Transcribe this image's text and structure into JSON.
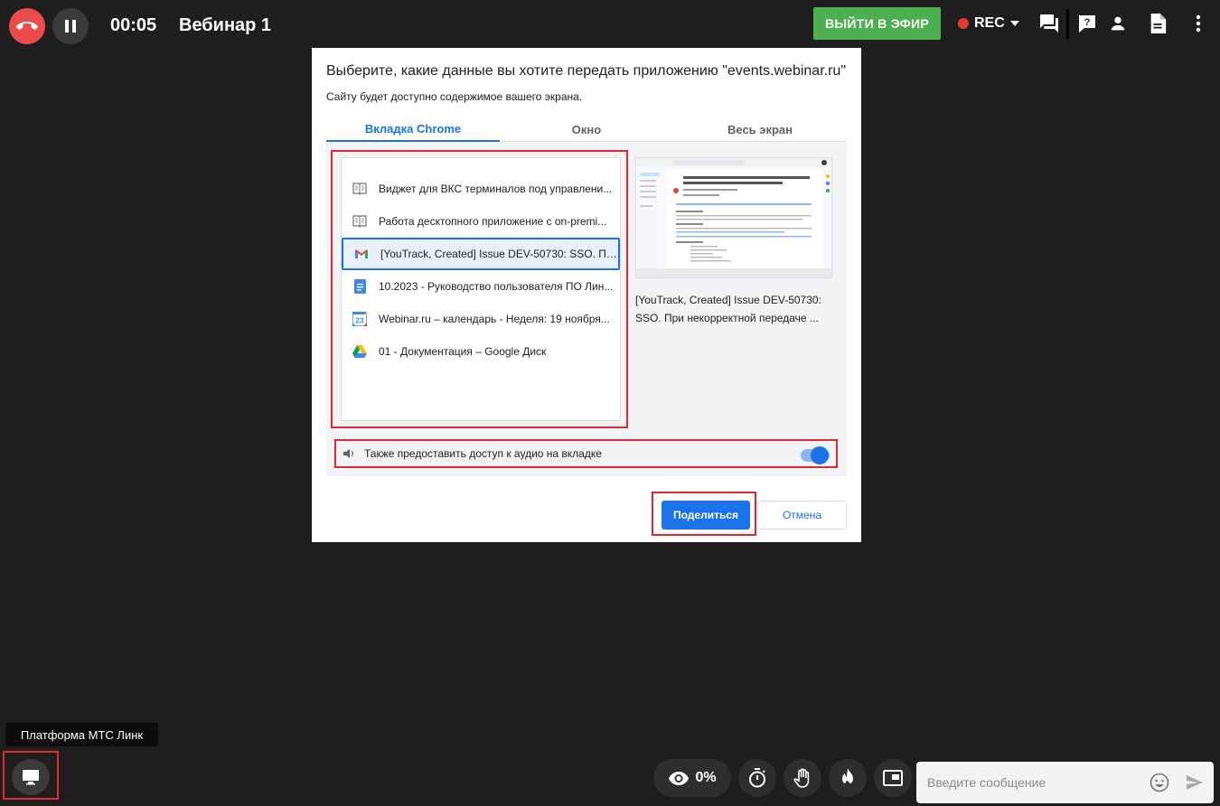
{
  "topbar": {
    "timer": "00:05",
    "title": "Вебинар 1",
    "live_button": "ВЫЙТИ В ЭФИР",
    "rec_label": "REC",
    "colors": {
      "live": "#4caf50",
      "hangup": "#ea4b4b",
      "rec_dot": "#e53935"
    }
  },
  "dialog": {
    "title": "Выберите, какие данные вы хотите передать приложению \"events.webinar.ru\"",
    "subtitle": "Сайту будет доступно содержимое вашего экрана.",
    "tabs": [
      {
        "label": "Вкладка Chrome",
        "active": true
      },
      {
        "label": "Окно",
        "active": false
      },
      {
        "label": "Весь экран",
        "active": false
      }
    ],
    "items": [
      {
        "label": "Виджет для ВКС терминалов под управлени...",
        "icon": "book-icon"
      },
      {
        "label": "Работа десктопного приложение с on-premi...",
        "icon": "book-icon"
      },
      {
        "label": "[YouTrack, Created] Issue DEV-50730: SSO. Пр...",
        "icon": "gmail-icon",
        "selected": true
      },
      {
        "label": "10.2023 - Руководство пользователя ПО Лин...",
        "icon": "docs-icon"
      },
      {
        "label": "Webinar.ru – календарь - Неделя: 19 ноября...",
        "icon": "calendar-icon",
        "icon_text": "23"
      },
      {
        "label": "01 - Документация – Google Диск",
        "icon": "drive-icon"
      }
    ],
    "preview_caption": "[YouTrack, Created] Issue DEV-50730: SSO. При некорректной передаче ...",
    "audio_label": "Также предоставить доступ к аудио на вкладке",
    "audio_enabled": true,
    "share_button": "Поделиться",
    "cancel_button": "Отмена",
    "accent": "#1a73e8"
  },
  "bottom": {
    "tooltip": "Платформа МТС Линк",
    "views_percent": "0%",
    "message_placeholder": "Введите сообщение"
  }
}
